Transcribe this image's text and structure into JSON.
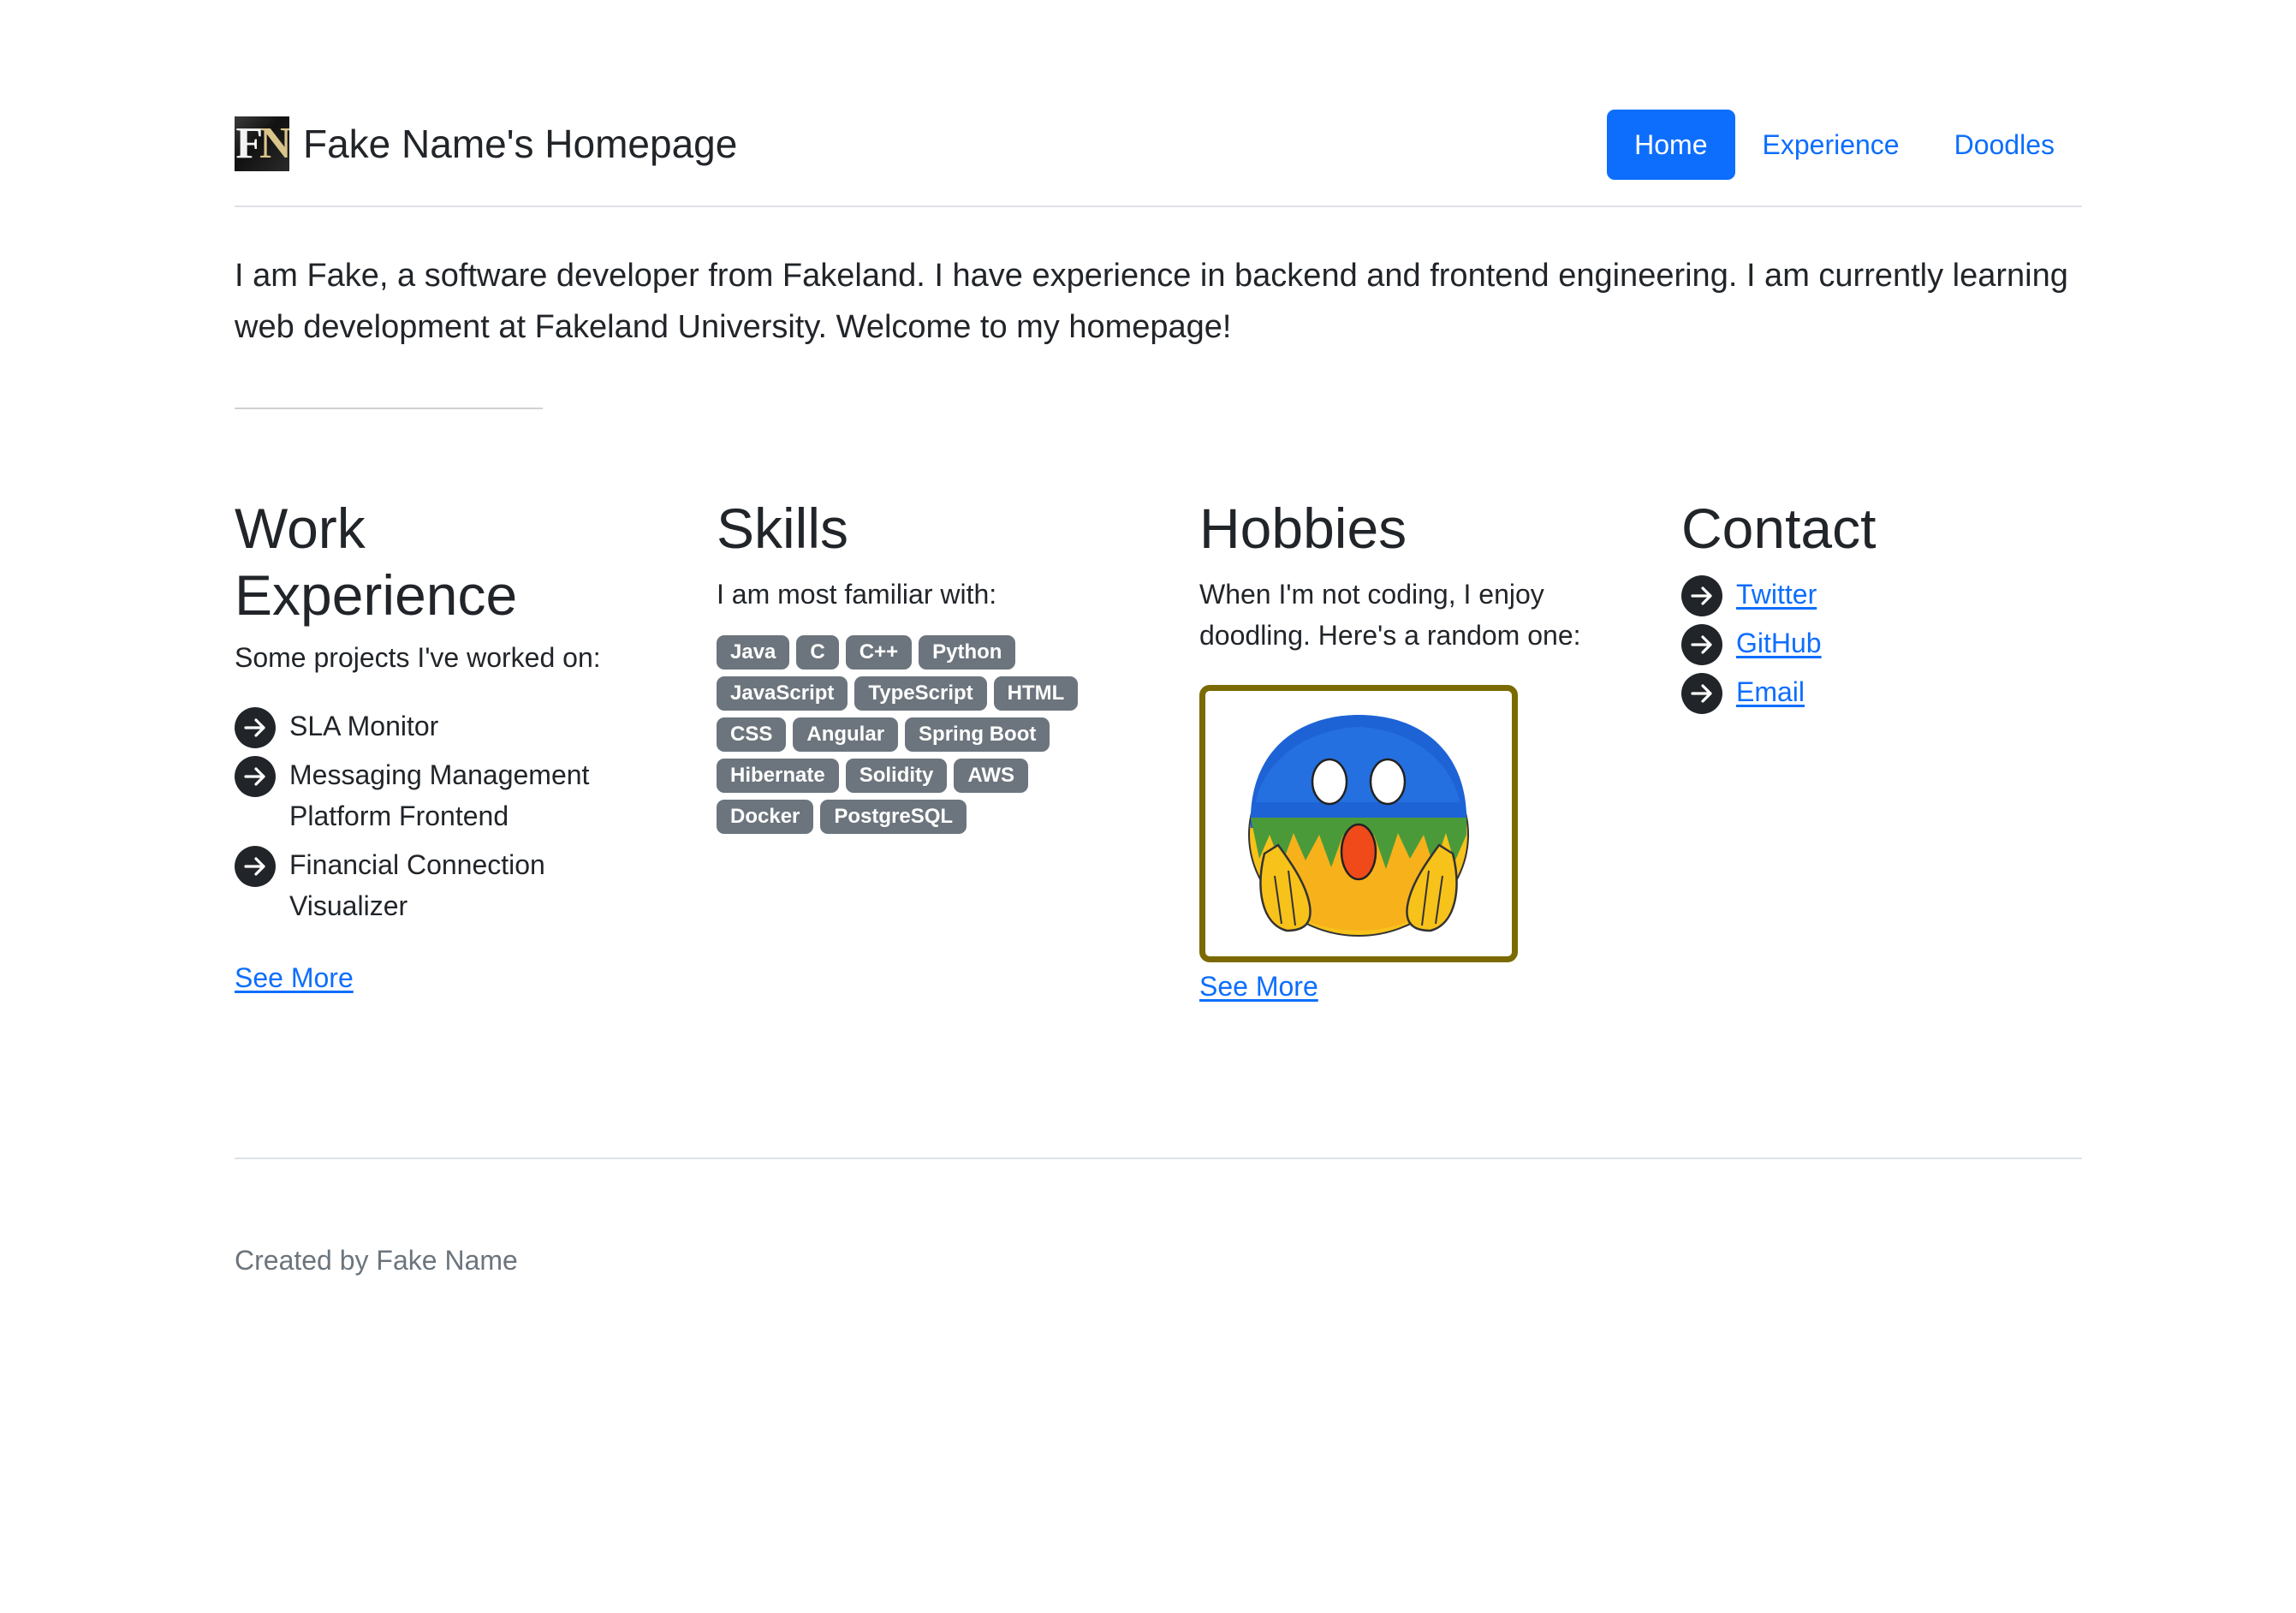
{
  "header": {
    "logo_text": "FN",
    "title": "Fake Name's Homepage",
    "nav": [
      {
        "label": "Home",
        "active": true
      },
      {
        "label": "Experience",
        "active": false
      },
      {
        "label": "Doodles",
        "active": false
      }
    ]
  },
  "intro": {
    "text": "I am Fake, a software developer from Fakeland. I have experience in backend and frontend engineering. I am currently learning web development at Fakeland University. Welcome to my homepage!"
  },
  "work": {
    "heading": "Work Experience",
    "subtitle": "Some projects I've worked on:",
    "projects": [
      "SLA Monitor",
      "Messaging Management Platform Frontend",
      "Financial Connection Visualizer"
    ],
    "see_more": "See More"
  },
  "skills": {
    "heading": "Skills",
    "subtitle": "I am most familiar with:",
    "badges": [
      "Java",
      "C",
      "C++",
      "Python",
      "JavaScript",
      "TypeScript",
      "HTML",
      "CSS",
      "Angular",
      "Spring Boot",
      "Hibernate",
      "Solidity",
      "AWS",
      "Docker",
      "PostgreSQL"
    ]
  },
  "hobbies": {
    "heading": "Hobbies",
    "subtitle": "When I'm not coding, I enjoy doodling. Here's a random one:",
    "see_more": "See More"
  },
  "contact": {
    "heading": "Contact",
    "links": [
      "Twitter",
      "GitHub",
      "Email"
    ]
  },
  "footer": {
    "text": "Created by Fake Name"
  },
  "colors": {
    "primary": "#0d6efd",
    "badge": "#6c757d",
    "doodle_frame": "#7a6a00",
    "text": "#212529",
    "muted": "#6c757d"
  },
  "icons": {
    "list_bullet": "arrow-right-circle-icon"
  }
}
